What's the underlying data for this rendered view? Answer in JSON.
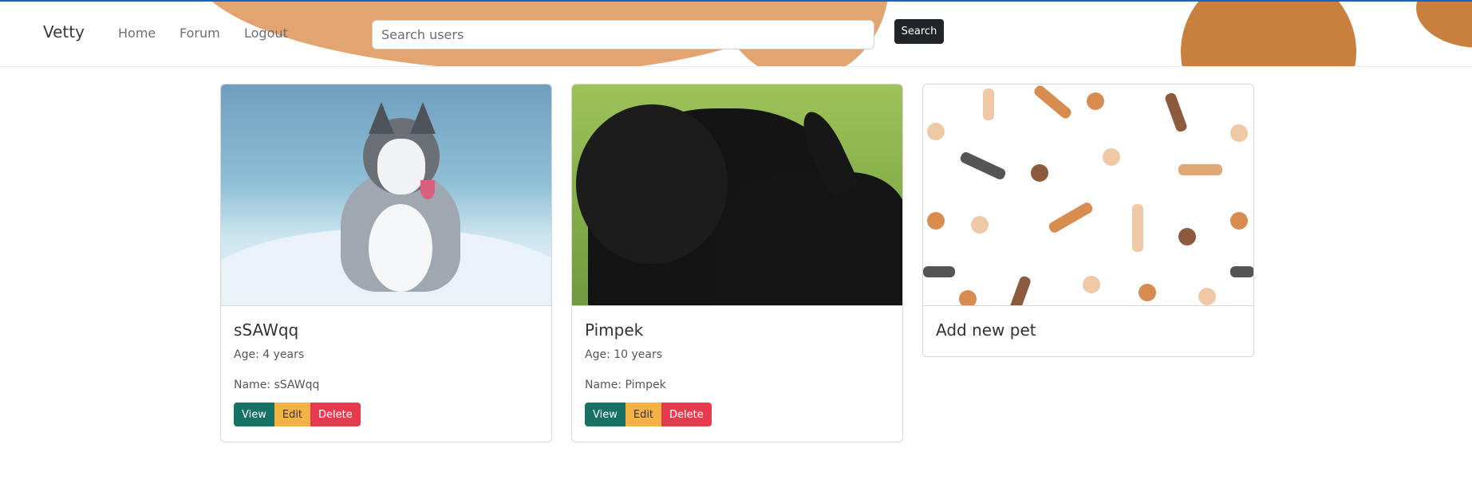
{
  "nav": {
    "brand": "Vetty",
    "links": [
      {
        "label": "Home"
      },
      {
        "label": "Forum"
      },
      {
        "label": "Logout"
      }
    ],
    "search": {
      "placeholder": "Search users",
      "value": "",
      "button": "Search"
    }
  },
  "pets": [
    {
      "title": "sSAWqq",
      "age": "Age: 4 years",
      "name": "Name: sSAWqq",
      "image": "husky-in-snow"
    },
    {
      "title": "Pimpek",
      "age": "Age: 10 years",
      "name": "Name: Pimpek",
      "image": "black-terrier-on-grass"
    }
  ],
  "add_card": {
    "title": "Add new pet",
    "image": "bones-and-paws-pattern"
  },
  "actions": {
    "view": "View",
    "edit": "Edit",
    "delete": "Delete"
  },
  "colors": {
    "accent_line": "#1565c0",
    "blob_light": "#e2a571",
    "blob_dark": "#c9803f",
    "view": "#177266",
    "edit": "#f3b244",
    "delete": "#e63a4e",
    "search_button": "#212529"
  }
}
